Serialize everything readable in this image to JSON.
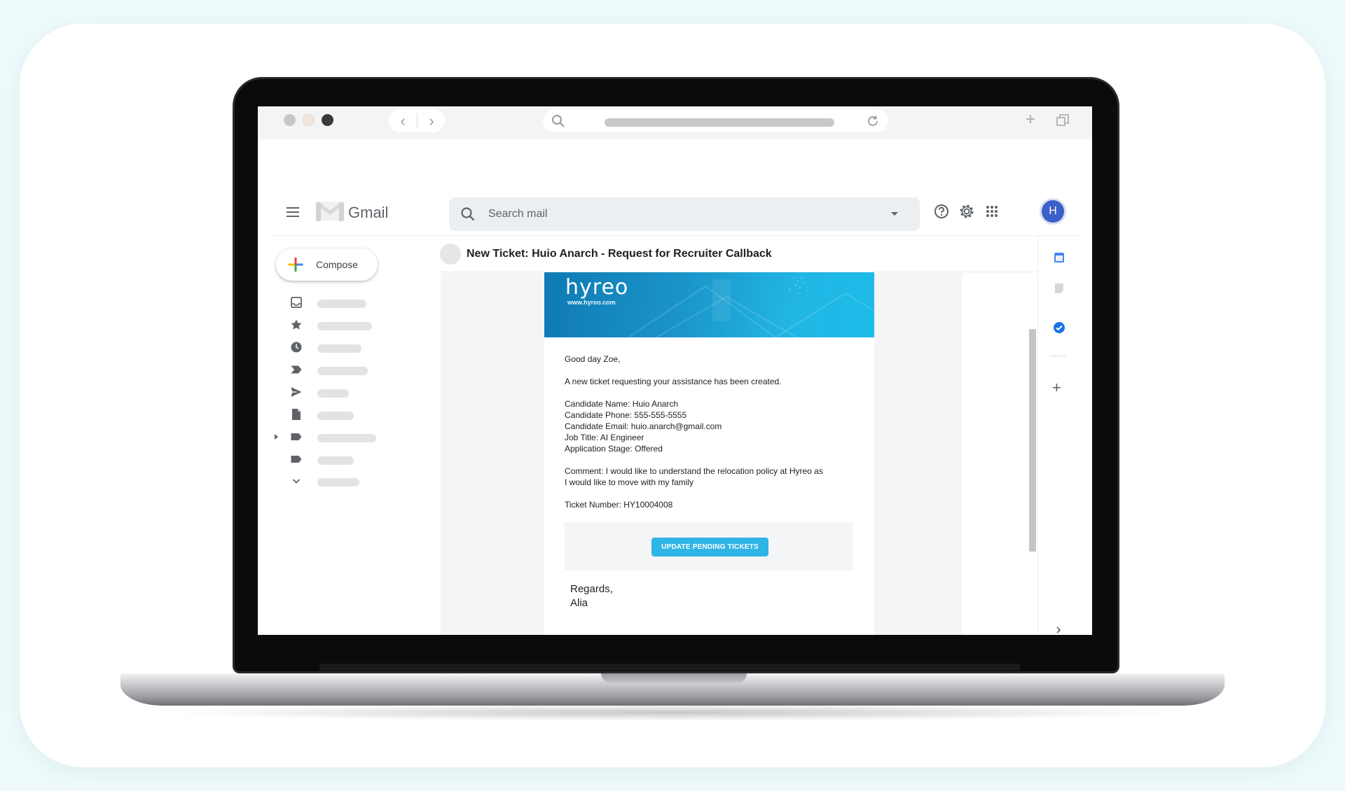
{
  "gmail": {
    "app_name": "Gmail",
    "search_placeholder": "Search mail",
    "avatar_initial": "H",
    "compose_label": "Compose"
  },
  "email": {
    "subject": "New Ticket: Huio Anarch - Request for Recruiter Callback",
    "brand": "hyreo",
    "brand_url": "www.hyreo.com",
    "greeting": "Good day Zoe,",
    "intro": "A new ticket requesting your assistance has been created.",
    "candidate_name": "Candidate Name: Huio Anarch",
    "candidate_phone": "Candidate Phone: 555-555-5555",
    "candidate_email": "Candidate Email: huio.anarch@gmail.com",
    "job_title": "Job Title: AI Engineer",
    "application_stage": "Application Stage: Offered",
    "comment_line1": "Comment: I would like to understand the relocation policy at Hyreo as",
    "comment_line2": "I would like to move with my family",
    "ticket_number": "Ticket Number: HY10004008",
    "button_label": "UPDATE PENDING TICKETS",
    "regards": "Regards,",
    "signature": "Alia"
  },
  "colors": {
    "banner_start": "#0f79b4",
    "banner_end": "#1cbbe8",
    "cta": "#2fb4e6",
    "avatar": "#3b5fc8"
  }
}
